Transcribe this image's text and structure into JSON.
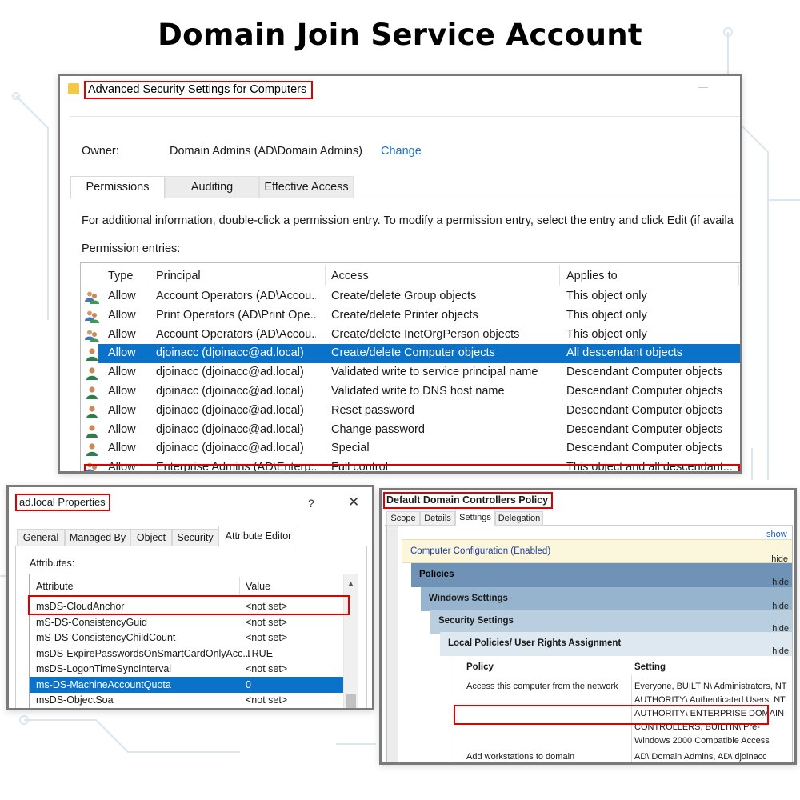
{
  "page_title": "Domain Join Service Account",
  "security_window": {
    "title": "Advanced Security Settings for Computers",
    "owner_label": "Owner:",
    "owner_value": "Domain Admins (AD\\Domain Admins)",
    "owner_change": "Change",
    "tabs": [
      "Permissions",
      "Auditing",
      "Effective Access"
    ],
    "active_tab": "Permissions",
    "info_text": "For additional information, double-click a permission entry. To modify a permission entry, select the entry and click Edit (if availa",
    "entries_label": "Permission entries:",
    "columns": [
      "Type",
      "Principal",
      "Access",
      "Applies to"
    ],
    "rows": [
      {
        "icon": "group-icon",
        "type": "Allow",
        "principal": "Account Operators (AD\\Accou...",
        "access": "Create/delete Group objects",
        "applies": "This object only"
      },
      {
        "icon": "group-icon",
        "type": "Allow",
        "principal": "Print Operators (AD\\Print Ope...",
        "access": "Create/delete Printer objects",
        "applies": "This object only"
      },
      {
        "icon": "group-icon",
        "type": "Allow",
        "principal": "Account Operators (AD\\Accou...",
        "access": "Create/delete InetOrgPerson objects",
        "applies": "This object only"
      },
      {
        "icon": "user-icon",
        "type": "Allow",
        "principal": "djoinacc (djoinacc@ad.local)",
        "access": "Create/delete Computer objects",
        "applies": "All descendant objects",
        "selected": true
      },
      {
        "icon": "user-icon",
        "type": "Allow",
        "principal": "djoinacc (djoinacc@ad.local)",
        "access": "Validated write to service principal name",
        "applies": "Descendant Computer objects"
      },
      {
        "icon": "user-icon",
        "type": "Allow",
        "principal": "djoinacc (djoinacc@ad.local)",
        "access": "Validated write to DNS host name",
        "applies": "Descendant Computer objects"
      },
      {
        "icon": "user-icon",
        "type": "Allow",
        "principal": "djoinacc (djoinacc@ad.local)",
        "access": "Reset password",
        "applies": "Descendant Computer objects"
      },
      {
        "icon": "user-icon",
        "type": "Allow",
        "principal": "djoinacc (djoinacc@ad.local)",
        "access": "Change password",
        "applies": "Descendant Computer objects"
      },
      {
        "icon": "user-icon",
        "type": "Allow",
        "principal": "djoinacc (djoinacc@ad.local)",
        "access": "Special",
        "applies": "Descendant Computer objects"
      },
      {
        "icon": "group-icon",
        "type": "Allow",
        "principal": "Enterprise Admins (AD\\Enterp...",
        "access": "Full control",
        "applies": "This object and all descendant..."
      }
    ]
  },
  "properties_window": {
    "title": "ad.local Properties",
    "help": "?",
    "close": "✕",
    "tabs": [
      "General",
      "Managed By",
      "Object",
      "Security",
      "Attribute Editor"
    ],
    "active_tab": "Attribute Editor",
    "attributes_label": "Attributes:",
    "columns": [
      "Attribute",
      "Value"
    ],
    "rows": [
      {
        "attr": "msDS-CloudAnchor",
        "value": "<not set>"
      },
      {
        "attr": "mS-DS-ConsistencyGuid",
        "value": "<not set>"
      },
      {
        "attr": "mS-DS-ConsistencyChildCount",
        "value": "<not set>"
      },
      {
        "attr": "msDS-ExpirePasswordsOnSmartCardOnlyAcc...",
        "value": "TRUE"
      },
      {
        "attr": "msDS-LogonTimeSyncInterval",
        "value": "<not set>"
      },
      {
        "attr": "ms-DS-MachineAccountQuota",
        "value": "0",
        "selected": true
      },
      {
        "attr": "msDS-ObjectSoa",
        "value": "<not set>"
      }
    ]
  },
  "policy_window": {
    "title": "Default Domain Controllers Policy",
    "tabs": [
      "Scope",
      "Details",
      "Settings",
      "Delegation"
    ],
    "active_tab": "Settings",
    "show_link": "show",
    "hide_label": "hide",
    "sections": {
      "computer_config": "Computer Configuration (Enabled)",
      "policies": "Policies",
      "windows_settings": "Windows Settings",
      "security_settings": "Security Settings",
      "local_policies": "Local Policies/ User Rights Assignment"
    },
    "columns": [
      "Policy",
      "Setting"
    ],
    "rows": [
      {
        "policy": "Access this computer from the network",
        "setting": "Everyone, BUILTIN\\ Administrators, NT AUTHORITY\\ Authenticated Users, NT AUTHORITY\\ ENTERPRISE DOMAIN CONTROLLERS, BUILTIN\\ Pre-Windows 2000 Compatible Access"
      },
      {
        "policy": "Add workstations to domain",
        "setting": "AD\\ Domain Admins, AD\\ djoinacc"
      }
    ]
  },
  "colors": {
    "highlight_red": "#e00000",
    "selection_blue": "#0a72c9",
    "link_blue": "#1a73c7"
  }
}
